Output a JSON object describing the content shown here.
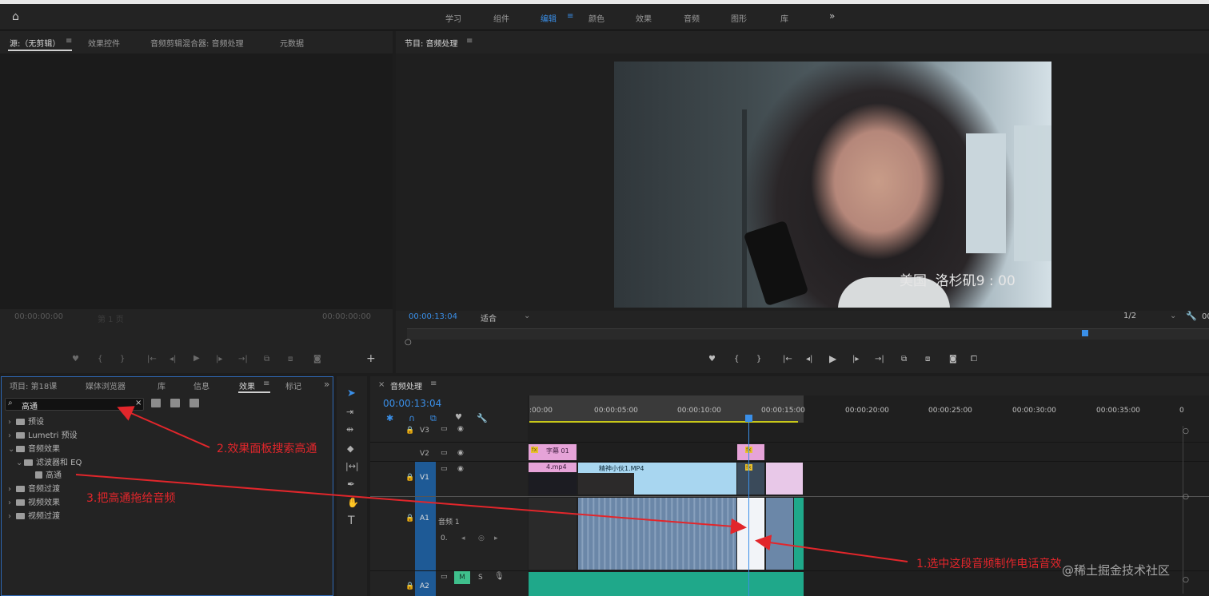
{
  "workspace": {
    "home_icon": "home-icon",
    "tabs": [
      "学习",
      "组件",
      "编辑",
      "颜色",
      "效果",
      "音频",
      "图形",
      "库"
    ],
    "active_tab": "编辑",
    "more": "»"
  },
  "source_panel": {
    "tabs": [
      "源:（无剪辑）",
      "效果控件",
      "音频剪辑混合器: 音频处理",
      "元数据"
    ],
    "menu": "≡",
    "timecode_left": "00:00:00:00",
    "page": "第 1 页",
    "timecode_right": "00:00:00:00",
    "add": "+"
  },
  "program_panel": {
    "title": "节目: 音频处理",
    "menu": "≡",
    "timecode": "00:00:13:04",
    "fit": "适合",
    "quality": "1/2",
    "overlay_text": "美国· 洛杉矶9 : 00",
    "extra": "00"
  },
  "project_panel": {
    "tabs": [
      "项目: 第18课",
      "媒体浏览器",
      "库",
      "信息",
      "效果",
      "标记"
    ],
    "active_tab": "效果",
    "menu": "≡",
    "more": "»",
    "search_value": "高通",
    "search_icon": "search-icon",
    "clear": "×",
    "tree": [
      {
        "label": "预设",
        "level": 0,
        "expanded": false
      },
      {
        "label": "Lumetri 预设",
        "level": 0,
        "expanded": false
      },
      {
        "label": "音频效果",
        "level": 0,
        "expanded": true
      },
      {
        "label": "滤波器和 EQ",
        "level": 1,
        "expanded": true
      },
      {
        "label": "高通",
        "level": 2,
        "expanded": false
      },
      {
        "label": "音频过渡",
        "level": 0,
        "expanded": false
      },
      {
        "label": "视频效果",
        "level": 0,
        "expanded": false
      },
      {
        "label": "视频过渡",
        "level": 0,
        "expanded": false
      }
    ]
  },
  "tools": [
    "selection-tool",
    "track-select-tool",
    "ripple-edit-tool",
    "razor-tool",
    "slip-tool",
    "pen-tool",
    "hand-tool",
    "type-tool"
  ],
  "timeline": {
    "title": "音频处理",
    "menu": "≡",
    "close": "×",
    "timecode": "00:00:13:04",
    "ruler": [
      ":00:00",
      "00:00:05:00",
      "00:00:10:00",
      "00:00:15:00",
      "00:00:20:00",
      "00:00:25:00",
      "00:00:30:00",
      "00:00:35:00",
      "0"
    ],
    "tracks": [
      {
        "name": "V3"
      },
      {
        "name": "V2"
      },
      {
        "name": "V1"
      },
      {
        "name": "A1",
        "label": "音频 1"
      },
      {
        "name": "A2"
      }
    ],
    "a1_vol": "0.",
    "a2_mute": "M",
    "a2_solo": "S",
    "clips": {
      "v2_title": "字幕 01",
      "v1_a": "4.mp4",
      "v1_b": "精神小伙1.MP4",
      "fx": "fx"
    }
  },
  "annotations": {
    "step1": "1.选中这段音频制作电话音效",
    "step2": "2.效果面板搜索高通",
    "step3": "3.把高通拖给音频"
  },
  "watermark": "@稀土掘金技术社区",
  "colors": {
    "accent": "#3a8fe8",
    "annotation": "#e2262b",
    "v_clip": "#a8d6f0",
    "a_clip": "#6b87a8",
    "a2_clip": "#1fa88a",
    "title_clip": "#e6a3d8"
  }
}
